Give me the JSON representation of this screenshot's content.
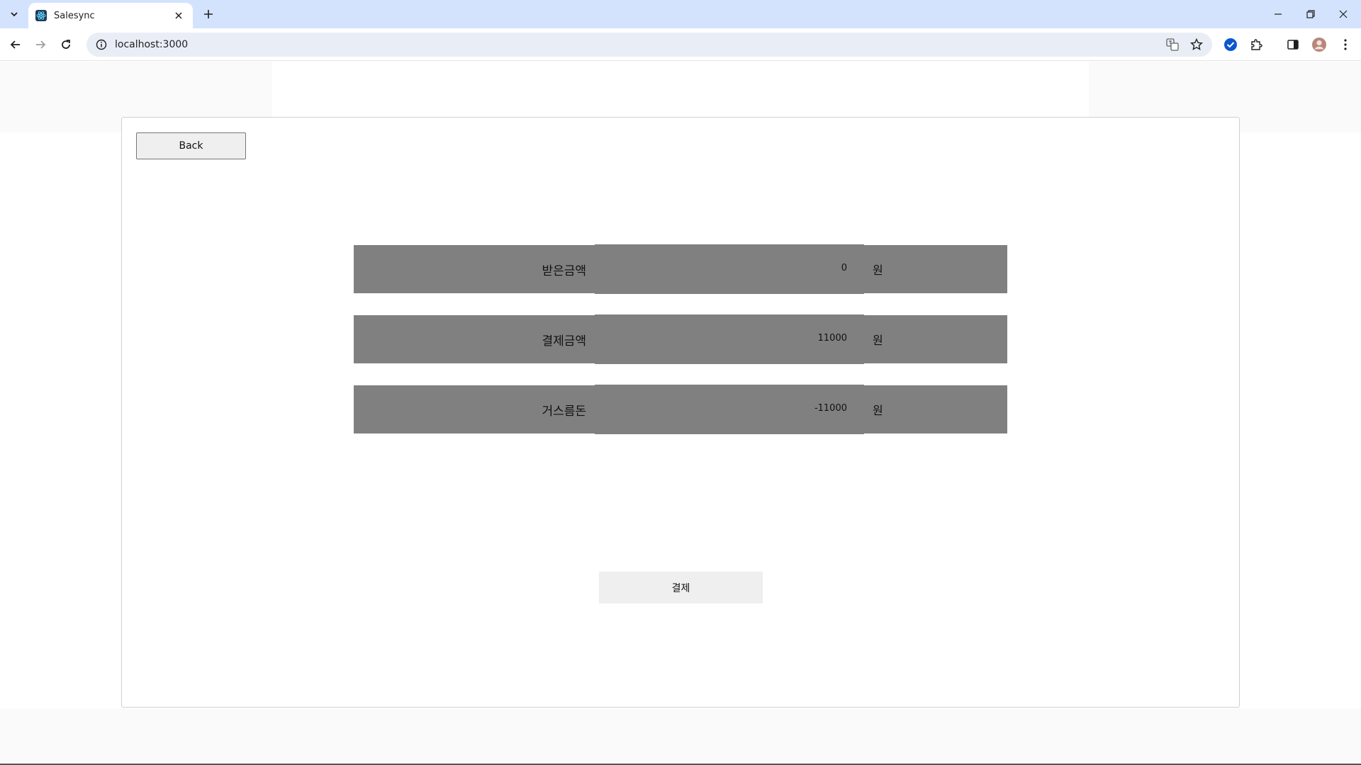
{
  "browser": {
    "tab_title": "Salesync",
    "url": "localhost:3000"
  },
  "page": {
    "back_label": "Back",
    "rows": [
      {
        "label": "받은금액",
        "value": "0",
        "unit": "원"
      },
      {
        "label": "결제금액",
        "value": "11000",
        "unit": "원"
      },
      {
        "label": "거스름돈",
        "value": "-11000",
        "unit": "원"
      }
    ],
    "pay_label": "결제"
  },
  "colors": {
    "tabbar": "#d3e3fd",
    "row_background": "#808080",
    "button_background": "#efefef"
  }
}
